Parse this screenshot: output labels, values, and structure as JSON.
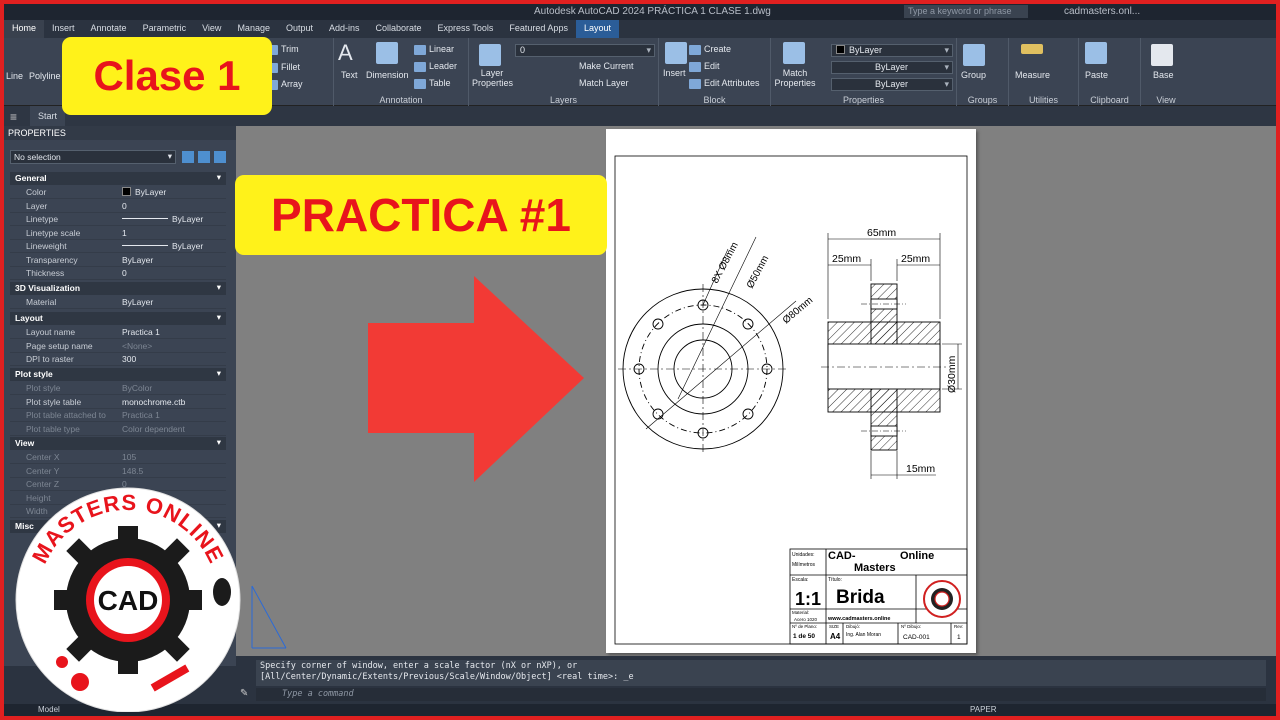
{
  "titlebar": {
    "title": "Autodesk AutoCAD 2024  PRÁCTICA 1 CLASE 1.dwg",
    "search_placeholder": "Type a keyword or phrase",
    "user": "cadmasters.onl..."
  },
  "tabs": [
    "Home",
    "Insert",
    "Annotate",
    "Parametric",
    "View",
    "Manage",
    "Output",
    "Add-ins",
    "Collaborate",
    "Express Tools",
    "Featured Apps",
    "Layout"
  ],
  "ribbon": {
    "draw": {
      "line": "Line",
      "polyline": "Polyline"
    },
    "modify": {
      "trim": "Trim",
      "fillet": "Fillet",
      "array": "Array"
    },
    "annotation": {
      "text": "Text",
      "dimension": "Dimension",
      "linear": "Linear",
      "leader": "Leader",
      "table": "Table",
      "title": "Annotation"
    },
    "layers": {
      "properties": "Layer Properties",
      "layer_value": "0",
      "make_current": "Make Current",
      "match_layer": "Match Layer",
      "title": "Layers"
    },
    "block": {
      "insert": "Insert",
      "create": "Create",
      "edit": "Edit",
      "edit_attributes": "Edit Attributes",
      "title": "Block"
    },
    "properties": {
      "match": "Match Properties",
      "color": "ByLayer",
      "linetype": "ByLayer",
      "lineweight": "ByLayer",
      "title": "Properties"
    },
    "groups": {
      "group": "Group",
      "title": "Groups"
    },
    "utilities": {
      "measure": "Measure",
      "title": "Utilities"
    },
    "clipboard": {
      "paste": "Paste",
      "title": "Clipboard"
    },
    "view": {
      "base": "Base",
      "title": "View"
    }
  },
  "filebar": {
    "start": "Start"
  },
  "properties": {
    "header": "PROPERTIES",
    "selection": "No selection",
    "sections": {
      "general": "General",
      "viz3d": "3D Visualization",
      "layout": "Layout",
      "plot": "Plot style",
      "view": "View",
      "misc": "Misc"
    },
    "general": [
      {
        "k": "Color",
        "v": "ByLayer"
      },
      {
        "k": "Layer",
        "v": "0"
      },
      {
        "k": "Linetype",
        "v": "ByLayer"
      },
      {
        "k": "Linetype scale",
        "v": "1"
      },
      {
        "k": "Lineweight",
        "v": "ByLayer"
      },
      {
        "k": "Transparency",
        "v": "ByLayer"
      },
      {
        "k": "Thickness",
        "v": "0"
      }
    ],
    "viz3d": [
      {
        "k": "Material",
        "v": "ByLayer"
      }
    ],
    "layout": [
      {
        "k": "Layout name",
        "v": "Practica 1"
      },
      {
        "k": "Page setup name",
        "v": "<None>"
      },
      {
        "k": "DPI to raster",
        "v": "300"
      }
    ],
    "plot": [
      {
        "k": "Plot style",
        "v": "ByColor"
      },
      {
        "k": "Plot style table",
        "v": "monochrome.ctb"
      },
      {
        "k": "Plot table attached to",
        "v": "Practica 1"
      },
      {
        "k": "Plot table type",
        "v": "Color dependent"
      }
    ],
    "view": [
      {
        "k": "Center X",
        "v": "105"
      },
      {
        "k": "Center Y",
        "v": "148.5"
      },
      {
        "k": "Center Z",
        "v": "0"
      },
      {
        "k": "Height",
        "v": ""
      },
      {
        "k": "Width",
        "v": ""
      }
    ]
  },
  "drawing": {
    "dim_65": "65mm",
    "dim_25a": "25mm",
    "dim_25b": "25mm",
    "dim_15": "15mm",
    "dim_30": "Ø30mm",
    "dim_holes": "8X Ø8mm",
    "dim_50": "Ø50mm",
    "dim_80": "Ø80mm"
  },
  "titleblock": {
    "units_label": "Unidades:",
    "units_value": "Milímetros",
    "company_1": "CAD-",
    "company_2": "Online",
    "company_3": "Masters",
    "scale_label": "Escala:",
    "scale_value": "1:1",
    "title_label": "Título:",
    "title_value": "Brida",
    "material_label": "Material:",
    "material_value": "Acero 1020",
    "website": "www.cadmasters.online",
    "sheet_label": "Nº de Plano:",
    "sheet_value": "1 de 50",
    "size_label": "SIZE",
    "size_value": "A4",
    "drawn_label": "Dibujó:",
    "drawn_value": "Ing. Alan Moran",
    "drawing_no_label": "Nº Dibujo:",
    "drawing_no_value": "CAD-001",
    "rev_label": "Rev:",
    "rev_value": "1"
  },
  "command": {
    "history_1": "Specify corner of window, enter a scale factor (nX or nXP), or",
    "history_2": "[All/Center/Dynamic/Extents/Previous/Scale/Window/Object] <real time>: _e",
    "placeholder": "Type a command"
  },
  "status": {
    "model": "Model",
    "paper": "PAPER"
  },
  "overlay": {
    "clase": "Clase 1",
    "practica": "PRACTICA #1",
    "logo_top": "MASTERS ONLINE",
    "logo_center": "CAD",
    "arrow_color": "#f23a35",
    "text_color": "#e8141c",
    "box_color": "#fff21a"
  }
}
